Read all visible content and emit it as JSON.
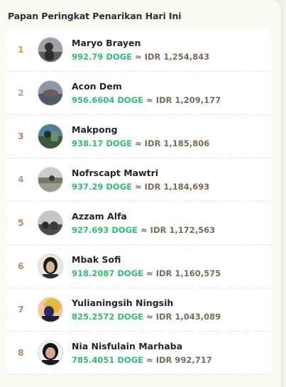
{
  "header": {
    "title": "Papan Peringkat Penarikan Hari Ini"
  },
  "leaderboard": [
    {
      "rank": "1",
      "name": "Maryo Brayen",
      "doge": "992.79 DOGE",
      "approx": "≈",
      "idr": "IDR 1,254,843"
    },
    {
      "rank": "2",
      "name": "Acon Dem",
      "doge": "956.6604 DOGE",
      "approx": "≈",
      "idr": "IDR 1,209,177"
    },
    {
      "rank": "3",
      "name": "Makpong",
      "doge": "938.17 DOGE",
      "approx": "≈",
      "idr": "IDR 1,185,806"
    },
    {
      "rank": "4",
      "name": "Nofrscapt Mawtri",
      "doge": "937.29 DOGE",
      "approx": "≈",
      "idr": "IDR 1,184,693"
    },
    {
      "rank": "5",
      "name": "Azzam Alfa",
      "doge": "927.693 DOGE",
      "approx": "≈",
      "idr": "IDR 1,172,563"
    },
    {
      "rank": "6",
      "name": "Mbak Sofi",
      "doge": "918.2087 DOGE",
      "approx": "≈",
      "idr": "IDR 1,160,575"
    },
    {
      "rank": "7",
      "name": "Yulianingsih Ningsih",
      "doge": "825.2572 DOGE",
      "approx": "≈",
      "idr": "IDR 1,043,089"
    },
    {
      "rank": "8",
      "name": "Nia Nisfulain Marhaba",
      "doge": "785.4051 DOGE",
      "approx": "≈",
      "idr": "IDR 992,717"
    }
  ],
  "colors": {
    "doge": "#2fbf71",
    "gold": "#d7a514",
    "bronze": "#b98a5d",
    "silver": "#a9a9a9"
  }
}
